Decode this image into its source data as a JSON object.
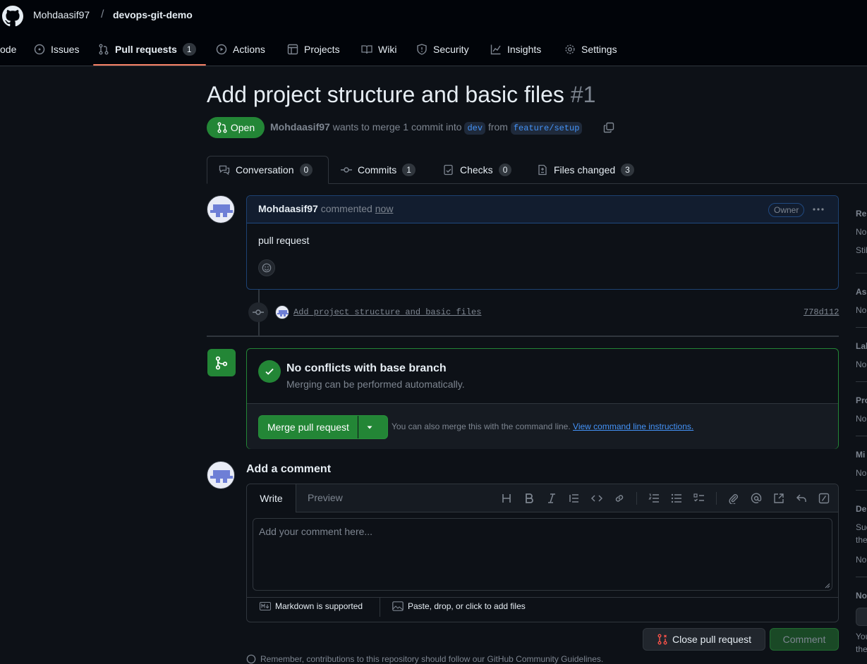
{
  "header": {
    "owner": "Mohdaasif97",
    "separator": "/",
    "repo": "devops-git-demo"
  },
  "nav": {
    "code": "ode",
    "issues": "Issues",
    "pull_requests": "Pull requests",
    "pull_requests_count": "1",
    "actions": "Actions",
    "projects": "Projects",
    "wiki": "Wiki",
    "security": "Security",
    "insights": "Insights",
    "settings": "Settings"
  },
  "pr": {
    "title": "Add project structure and basic files",
    "number": "#1",
    "state": "Open",
    "author": "Mohdaasif97",
    "meta_text": "wants to merge 1 commit into",
    "base_branch": "dev",
    "from_text": "from",
    "head_branch": "feature/setup"
  },
  "tabs": [
    {
      "label": "Conversation",
      "count": "0"
    },
    {
      "label": "Commits",
      "count": "1"
    },
    {
      "label": "Checks",
      "count": "0"
    },
    {
      "label": "Files changed",
      "count": "3"
    }
  ],
  "comment": {
    "author": "Mohdaasif97",
    "action": "commented",
    "time": "now",
    "badge": "Owner",
    "body": "pull request"
  },
  "commit": {
    "message": "Add project structure and basic files",
    "sha": "778d112"
  },
  "merge": {
    "title": "No conflicts with base branch",
    "subtitle": "Merging can be performed automatically.",
    "button": "Merge pull request",
    "hint": "You can also merge this with the command line.",
    "link": "View command line instructions."
  },
  "add_comment": {
    "heading": "Add a comment",
    "tab_write": "Write",
    "tab_preview": "Preview",
    "placeholder": "Add your comment here...",
    "markdown_note": "Markdown is supported",
    "attach_note": "Paste, drop, or click to add files",
    "close_button": "Close pull request",
    "comment_button": "Comment"
  },
  "footer_note": "Remember, contributions to this repository should follow our GitHub Community Guidelines.",
  "sidebar": [
    {
      "label": "Re",
      "values": [
        "No",
        "Stil"
      ]
    },
    {
      "label": "Ass",
      "values": [
        "No"
      ]
    },
    {
      "label": "Lab",
      "values": [
        "No"
      ]
    },
    {
      "label": "Pro",
      "values": [
        "No"
      ]
    },
    {
      "label": "Mi",
      "values": [
        "No"
      ]
    },
    {
      "label": "De",
      "values": [
        "Suc",
        "the",
        "No"
      ]
    },
    {
      "label": "No",
      "values": [
        "You",
        "the"
      ]
    }
  ],
  "colors": {
    "accent_green": "#238636",
    "link_blue": "#4493f8",
    "active_tab": "#f78166"
  }
}
